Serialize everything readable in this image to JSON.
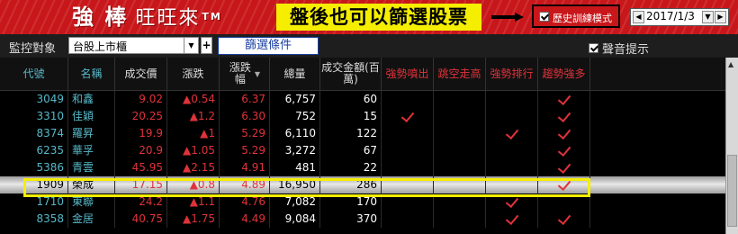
{
  "brand": {
    "title_bold": "強 棒",
    "title_rest": "旺旺來",
    "tm": "TM"
  },
  "annotation": "盤後也可以篩選股票",
  "history": {
    "checked": true,
    "label": "歷史訓練模式",
    "date": "2017/1/3"
  },
  "toolbar": {
    "monitor_label": "監控對象",
    "market_selected": "台股上市櫃",
    "plus_label": "+",
    "filter_button": "篩選條件",
    "sound_checked": true,
    "sound_label": "聲音提示"
  },
  "columns": [
    "代號",
    "名稱",
    "成交價",
    "漲跌",
    "漲跌幅",
    "總量",
    "成交金額(百萬)",
    "強勢噴出",
    "跳空走高",
    "強勢排行",
    "趨勢強多"
  ],
  "rows": [
    {
      "code": "3049",
      "name": "和鑫",
      "price": "9.02",
      "change": "▲0.54",
      "pct": "6.37",
      "volume": "6,757",
      "amount": "60",
      "flags": [
        false,
        false,
        false,
        true
      ],
      "selected": false
    },
    {
      "code": "3310",
      "name": "佳穎",
      "price": "20.25",
      "change": "▲1.2",
      "pct": "6.30",
      "volume": "752",
      "amount": "15",
      "flags": [
        true,
        false,
        false,
        true
      ],
      "selected": false
    },
    {
      "code": "8374",
      "name": "羅昇",
      "price": "19.9",
      "change": "▲1",
      "pct": "5.29",
      "volume": "6,110",
      "amount": "122",
      "flags": [
        false,
        false,
        true,
        true
      ],
      "selected": false
    },
    {
      "code": "6235",
      "name": "華孚",
      "price": "20.9",
      "change": "▲1.05",
      "pct": "5.29",
      "volume": "3,272",
      "amount": "67",
      "flags": [
        false,
        false,
        false,
        true
      ],
      "selected": false
    },
    {
      "code": "5386",
      "name": "青雲",
      "price": "45.95",
      "change": "▲2.15",
      "pct": "4.91",
      "volume": "481",
      "amount": "22",
      "flags": [
        false,
        false,
        false,
        true
      ],
      "selected": false
    },
    {
      "code": "1909",
      "name": "榮成",
      "price": "17.15",
      "change": "▲0.8",
      "pct": "4.89",
      "volume": "16,950",
      "amount": "286",
      "flags": [
        false,
        false,
        false,
        true
      ],
      "selected": true
    },
    {
      "code": "1710",
      "name": "東聯",
      "price": "24.2",
      "change": "▲1.1",
      "pct": "4.76",
      "volume": "7,082",
      "amount": "170",
      "flags": [
        false,
        false,
        true,
        false
      ],
      "selected": false
    },
    {
      "code": "8358",
      "name": "金居",
      "price": "40.75",
      "change": "▲1.75",
      "pct": "4.49",
      "volume": "9,084",
      "amount": "370",
      "flags": [
        false,
        false,
        true,
        true
      ],
      "selected": false
    }
  ],
  "colors": {
    "brand_red": "#c8171b",
    "annotation_yellow": "#f5ee00",
    "up_red": "#e0323a",
    "code_teal": "#56b8c8"
  }
}
